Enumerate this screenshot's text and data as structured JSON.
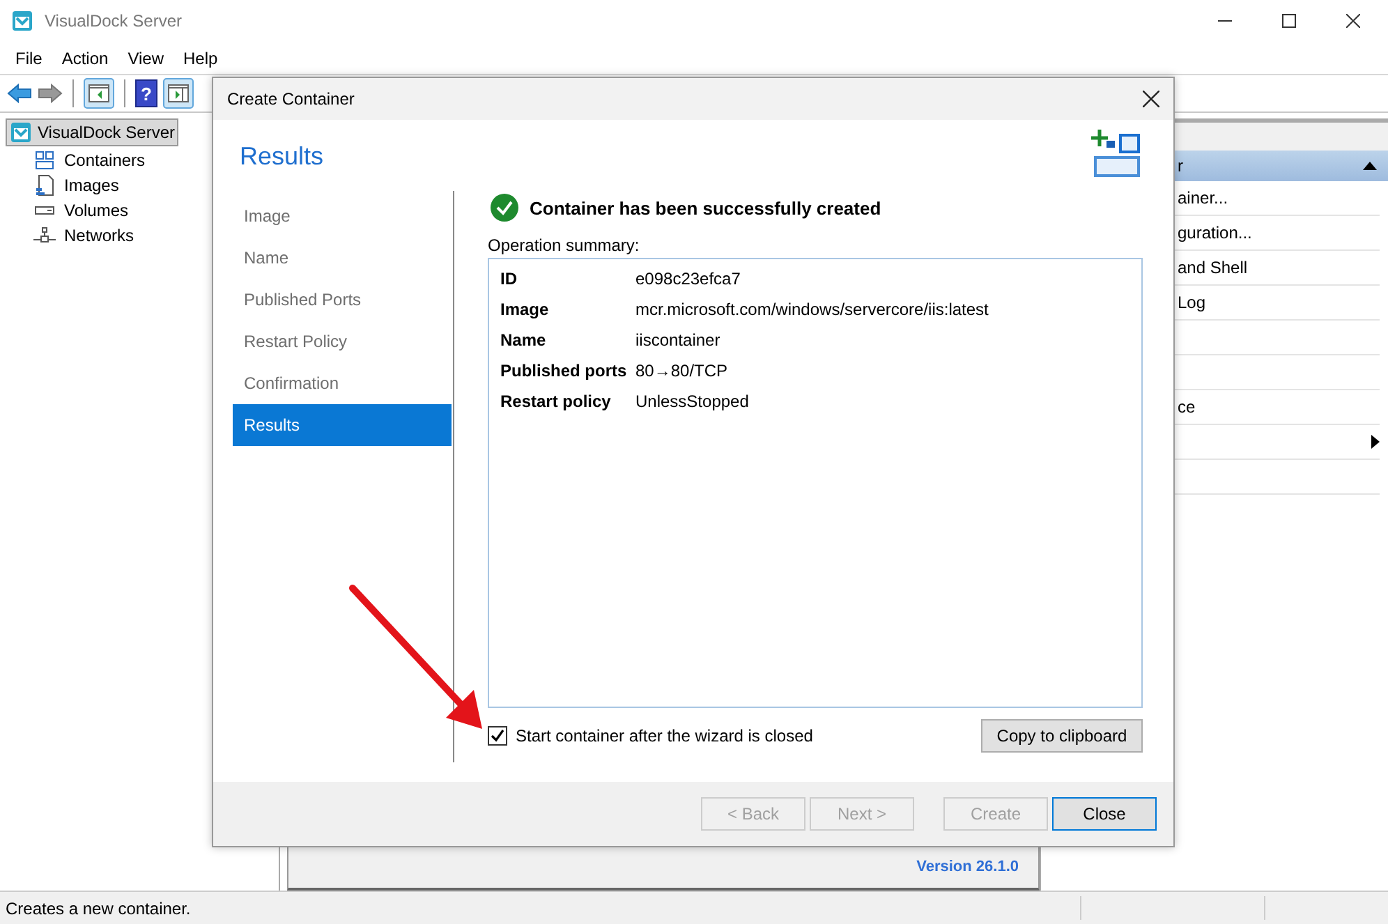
{
  "window": {
    "title": "VisualDock Server"
  },
  "menu": [
    "File",
    "Action",
    "View",
    "Help"
  ],
  "toolbar": {
    "help_glyph": "?"
  },
  "tree": {
    "label": "VisualDock Server",
    "selected": true,
    "children": [
      {
        "label": "Containers",
        "selected": false
      },
      {
        "label": "Images",
        "selected": false
      },
      {
        "label": "Volumes",
        "selected": false
      },
      {
        "label": "Networks",
        "selected": false
      }
    ]
  },
  "actions": {
    "header": "r",
    "items": [
      {
        "kind": "text",
        "label": "ainer..."
      },
      {
        "kind": "text",
        "label": "guration..."
      },
      {
        "kind": "text",
        "label": "and Shell"
      },
      {
        "kind": "text",
        "label": "Log"
      },
      {
        "kind": "blank"
      },
      {
        "kind": "blank"
      },
      {
        "kind": "text",
        "label": "ce"
      },
      {
        "kind": "submenu"
      },
      {
        "kind": "blank"
      }
    ]
  },
  "version": "Version 26.1.0",
  "status_bar": "Creates a new container.",
  "dialog": {
    "title": "Create Container",
    "heading": "Results",
    "steps": [
      {
        "label": "Image",
        "selected": false
      },
      {
        "label": "Name",
        "selected": false
      },
      {
        "label": "Published Ports",
        "selected": false
      },
      {
        "label": "Restart Policy",
        "selected": false
      },
      {
        "label": "Confirmation",
        "selected": false
      },
      {
        "label": "Results",
        "selected": true
      }
    ],
    "message": "Container has been successfully created",
    "summary_label": "Operation summary:",
    "summary": [
      {
        "key": "ID",
        "value": "e098c23efca7"
      },
      {
        "key": "Image",
        "value": "mcr.microsoft.com/windows/servercore/iis:latest"
      },
      {
        "key": "Name",
        "value": "iiscontainer"
      },
      {
        "key": "Published ports",
        "value": "80→80/TCP"
      },
      {
        "key": "Restart policy",
        "value": "UnlessStopped"
      }
    ],
    "start_checkbox": {
      "label": "Start container after the wizard is closed",
      "checked": true
    },
    "copy_button": "Copy to clipboard",
    "buttons": [
      {
        "label": "< Back",
        "disabled": true,
        "default": false
      },
      {
        "label": "Next >",
        "disabled": true,
        "default": false
      },
      {
        "label": "Create",
        "disabled": true,
        "default": false
      },
      {
        "label": "Close",
        "disabled": false,
        "default": true
      }
    ]
  }
}
